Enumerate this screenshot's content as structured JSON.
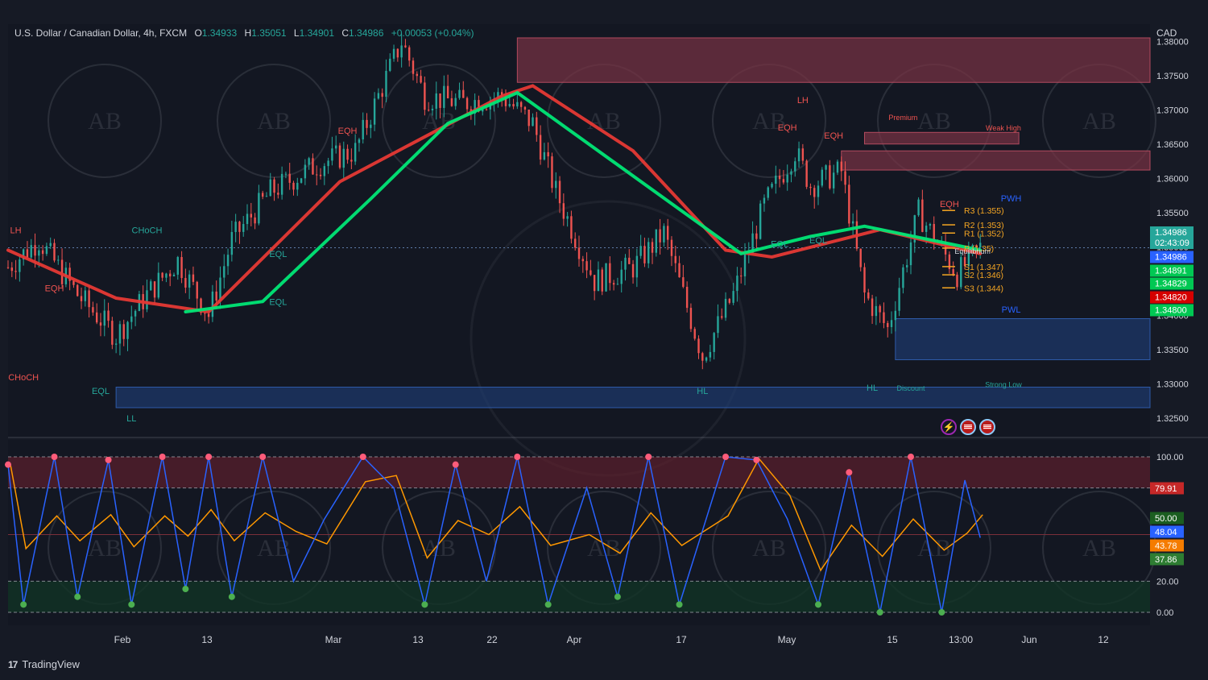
{
  "header": {
    "symbol": "U.S. Dollar / Canadian Dollar, 4h, FXCM",
    "o_label": "O",
    "o_value": "1.34933",
    "h_label": "H",
    "h_value": "1.35051",
    "l_label": "L",
    "l_value": "1.34901",
    "c_label": "C",
    "c_value": "1.34986",
    "change": "+0.00053 (+0.04%)"
  },
  "currency": "CAD",
  "brand": {
    "logo": "17",
    "name": "TradingView"
  },
  "colors": {
    "background": "#131722",
    "up": "#26a69a",
    "down": "#ef5350",
    "ema_slow": "#e53935",
    "ema_fast": "#00e676",
    "supply_zone": "#7a3344",
    "demand_zone": "#1e3a6e",
    "stoch_k": "#2962ff",
    "stoch_d": "#ff9800"
  },
  "chart_data": [
    {
      "type": "line",
      "subtype": "candlestick-price",
      "y_range": [
        1.3225,
        1.3825
      ],
      "y_ticks": [
        "1.38000",
        "1.37500",
        "1.37000",
        "1.36500",
        "1.36000",
        "1.35500",
        "1.35000",
        "1.34500",
        "1.34000",
        "1.33500",
        "1.33000",
        "1.32500"
      ],
      "x_ticks": [
        "Feb",
        "13",
        "Mar",
        "13",
        "22",
        "Apr",
        "17",
        "May",
        "15",
        "13:00",
        "Jun",
        "12"
      ],
      "price_path": [
        [
          "Jan 18",
          1.347
        ],
        [
          "Jan 22",
          1.351
        ],
        [
          "Jan 27",
          1.343
        ],
        [
          "Feb 01",
          1.337
        ],
        [
          "Feb 05",
          1.343
        ],
        [
          "Feb 09",
          1.348
        ],
        [
          "Feb 13",
          1.34
        ],
        [
          "Feb 16",
          1.351
        ],
        [
          "Feb 21",
          1.358
        ],
        [
          "Feb 27",
          1.362
        ],
        [
          "Mar 03",
          1.364
        ],
        [
          "Mar 06",
          1.372
        ],
        [
          "Mar 09",
          1.38
        ],
        [
          "Mar 12",
          1.372
        ],
        [
          "Mar 17",
          1.371
        ],
        [
          "Mar 22",
          1.372
        ],
        [
          "Mar 26",
          1.368
        ],
        [
          "Mar 29",
          1.358
        ],
        [
          "Apr 03",
          1.345
        ],
        [
          "Apr 08",
          1.347
        ],
        [
          "Apr 12",
          1.352
        ],
        [
          "Apr 17",
          1.334
        ],
        [
          "Apr 21",
          1.343
        ],
        [
          "Apr 25",
          1.356
        ],
        [
          "Apr 29",
          1.364
        ],
        [
          "May 01",
          1.359
        ],
        [
          "May 05",
          1.361
        ],
        [
          "May 08",
          1.343
        ],
        [
          "May 11",
          1.338
        ],
        [
          "May 15",
          1.355
        ],
        [
          "May 20",
          1.346
        ],
        [
          "May 23",
          1.34986
        ]
      ],
      "series": [
        {
          "name": "EMA slow",
          "color": "#e53935",
          "path": [
            [
              "Jan 18",
              1.3495
            ],
            [
              "Feb 01",
              1.3425
            ],
            [
              "Feb 13",
              1.3405
            ],
            [
              "Mar 01",
              1.3595
            ],
            [
              "Mar 22",
              1.372
            ],
            [
              "Mar 26",
              1.3735
            ],
            [
              "Apr 08",
              1.364
            ],
            [
              "Apr 20",
              1.3495
            ],
            [
              "Apr 26",
              1.3485
            ],
            [
              "May 10",
              1.3525
            ],
            [
              "May 23",
              1.349
            ]
          ]
        },
        {
          "name": "EMA fast",
          "color": "#00e676",
          "path": [
            [
              "Feb 10",
              1.3405
            ],
            [
              "Feb 20",
              1.342
            ],
            [
              "Mar 05",
              1.357
            ],
            [
              "Mar 15",
              1.368
            ],
            [
              "Mar 24",
              1.3725
            ],
            [
              "Apr 22",
              1.349
            ],
            [
              "May 01",
              1.3515
            ],
            [
              "May 08",
              1.353
            ],
            [
              "May 23",
              1.3495
            ]
          ]
        }
      ],
      "zones": [
        {
          "label": "",
          "from": "Mar 24",
          "to": "Jun 14",
          "top": 1.3805,
          "bottom": 1.374,
          "kind": "supply"
        },
        {
          "label": "Premium",
          "from": "May 08",
          "to": "May 28",
          "top": 1.3667,
          "bottom": 1.365,
          "kind": "supply"
        },
        {
          "label": "",
          "from": "May 05",
          "to": "Jun 14",
          "top": 1.364,
          "bottom": 1.3612,
          "kind": "supply"
        },
        {
          "label": "",
          "from": "May 12",
          "to": "Jun 14",
          "top": 1.3395,
          "bottom": 1.3335,
          "kind": "demand"
        },
        {
          "label": "",
          "from": "Feb 01",
          "to": "Jun 14",
          "top": 1.3295,
          "bottom": 1.3265,
          "kind": "demand"
        }
      ],
      "levels": [
        {
          "label": "R3 (1.355)",
          "value": 1.3553
        },
        {
          "label": "R2 (1.353)",
          "value": 1.3532
        },
        {
          "label": "R1 (1.352)",
          "value": 1.352
        },
        {
          "label": "P (1.35)",
          "value": 1.3498
        },
        {
          "label": "S1 (1.347)",
          "value": 1.3471
        },
        {
          "label": "S2 (1.346)",
          "value": 1.3459
        },
        {
          "label": "S3 (1.344)",
          "value": 1.344
        }
      ],
      "annotations": [
        {
          "text": "LH",
          "x": "Jan 19",
          "y": 1.352,
          "color": "#ef5350"
        },
        {
          "text": "CHoCH",
          "x": "Feb 05",
          "y": 1.352,
          "color": "#26a69a"
        },
        {
          "text": "EQH",
          "x": "Jan 24",
          "y": 1.3435,
          "color": "#ef5350"
        },
        {
          "text": "CHoCH",
          "x": "Jan 20",
          "y": 1.3305,
          "color": "#ef5350"
        },
        {
          "text": "EQL",
          "x": "Jan 30",
          "y": 1.3285,
          "color": "#26a69a"
        },
        {
          "text": "LL",
          "x": "Feb 03",
          "y": 1.3245,
          "color": "#26a69a"
        },
        {
          "text": "EQH",
          "x": "Mar 02",
          "y": 1.3665,
          "color": "#ef5350"
        },
        {
          "text": "EQL",
          "x": "Feb 22",
          "y": 1.3485,
          "color": "#26a69a"
        },
        {
          "text": "EQL",
          "x": "Feb 22",
          "y": 1.3415,
          "color": "#26a69a"
        },
        {
          "text": "HL",
          "x": "Apr 17",
          "y": 1.3285,
          "color": "#26a69a"
        },
        {
          "text": "LH",
          "x": "Apr 30",
          "y": 1.371,
          "color": "#ef5350"
        },
        {
          "text": "EQH",
          "x": "Apr 28",
          "y": 1.367,
          "color": "#ef5350"
        },
        {
          "text": "EQH",
          "x": "May 04",
          "y": 1.3658,
          "color": "#ef5350"
        },
        {
          "text": "EQL",
          "x": "Apr 27",
          "y": 1.35,
          "color": "#26a69a"
        },
        {
          "text": "EQL",
          "x": "May 02",
          "y": 1.3505,
          "color": "#26a69a"
        },
        {
          "text": "EQH",
          "x": "May 19",
          "y": 1.3558,
          "color": "#ef5350"
        },
        {
          "text": "HL",
          "x": "May 09",
          "y": 1.329,
          "color": "#26a69a"
        },
        {
          "text": "Premium",
          "x": "May 13",
          "y": 1.3685,
          "color": "#ef5350"
        },
        {
          "text": "Discount",
          "x": "May 14",
          "y": 1.329,
          "color": "#26a69a"
        },
        {
          "text": "Equilibrium",
          "x": "May 22",
          "y": 1.349,
          "color": "#d1d4dc"
        },
        {
          "text": "PWH",
          "x": "May 27",
          "y": 1.3566,
          "color": "#2962ff"
        },
        {
          "text": "PWL",
          "x": "May 27",
          "y": 1.3404,
          "color": "#2962ff"
        },
        {
          "text": "Weak High",
          "x": "May 26",
          "y": 1.367,
          "color": "#ef5350"
        },
        {
          "text": "Strong Low",
          "x": "May 26",
          "y": 1.3295,
          "color": "#26a69a"
        }
      ],
      "price_labels": [
        {
          "text": "1.34986",
          "sub": "02:43:09",
          "value": 1.34986,
          "color": "#26a69a"
        },
        {
          "text": "1.34986",
          "value": 1.34986,
          "color": "#2962ff"
        },
        {
          "text": "1.34891",
          "value": 1.34891,
          "color": "#00c853"
        },
        {
          "text": "1.34829",
          "value": 1.34829,
          "color": "#00c853"
        },
        {
          "text": "1.34820",
          "value": 1.3482,
          "color": "#d50000"
        },
        {
          "text": "1.34800",
          "value": 1.348,
          "color": "#00c853"
        }
      ]
    },
    {
      "type": "line",
      "subtype": "stochastic-oscillator",
      "y_range": [
        0,
        100
      ],
      "y_ticks": [
        "100.00",
        "20.00",
        "0.00"
      ],
      "bands": [
        80,
        20
      ],
      "k_path": [
        [
          "Jan 18",
          95
        ],
        [
          "Jan 20",
          5
        ],
        [
          "Jan 24",
          100
        ],
        [
          "Jan 27",
          10
        ],
        [
          "Jan 31",
          98
        ],
        [
          "Feb 03",
          5
        ],
        [
          "Feb 07",
          100
        ],
        [
          "Feb 10",
          15
        ],
        [
          "Feb 13",
          100
        ],
        [
          "Feb 16",
          10
        ],
        [
          "Feb 20",
          100
        ],
        [
          "Feb 24",
          20
        ],
        [
          "Feb 28",
          60
        ],
        [
          "Mar 04",
          100
        ],
        [
          "Mar 08",
          80
        ],
        [
          "Mar 12",
          5
        ],
        [
          "Mar 16",
          95
        ],
        [
          "Mar 20",
          20
        ],
        [
          "Mar 24",
          100
        ],
        [
          "Mar 28",
          5
        ],
        [
          "Apr 02",
          80
        ],
        [
          "Apr 06",
          10
        ],
        [
          "Apr 10",
          100
        ],
        [
          "Apr 14",
          5
        ],
        [
          "Apr 20",
          100
        ],
        [
          "Apr 24",
          98
        ],
        [
          "Apr 28",
          60
        ],
        [
          "May 02",
          5
        ],
        [
          "May 06",
          90
        ],
        [
          "May 10",
          0
        ],
        [
          "May 14",
          100
        ],
        [
          "May 18",
          0
        ],
        [
          "May 21",
          85
        ],
        [
          "May 23",
          48
        ]
      ],
      "price_labels": [
        {
          "text": "79.91",
          "value": 79.91,
          "color": "#c62828"
        },
        {
          "text": "50.00",
          "value": 50.0,
          "color": "#1b5e20"
        },
        {
          "text": "48.04",
          "value": 48.04,
          "color": "#2962ff"
        },
        {
          "text": "43.78",
          "value": 43.78,
          "color": "#f57c00"
        },
        {
          "text": "37.86",
          "value": 37.86,
          "color": "#2e7d32"
        }
      ]
    }
  ]
}
